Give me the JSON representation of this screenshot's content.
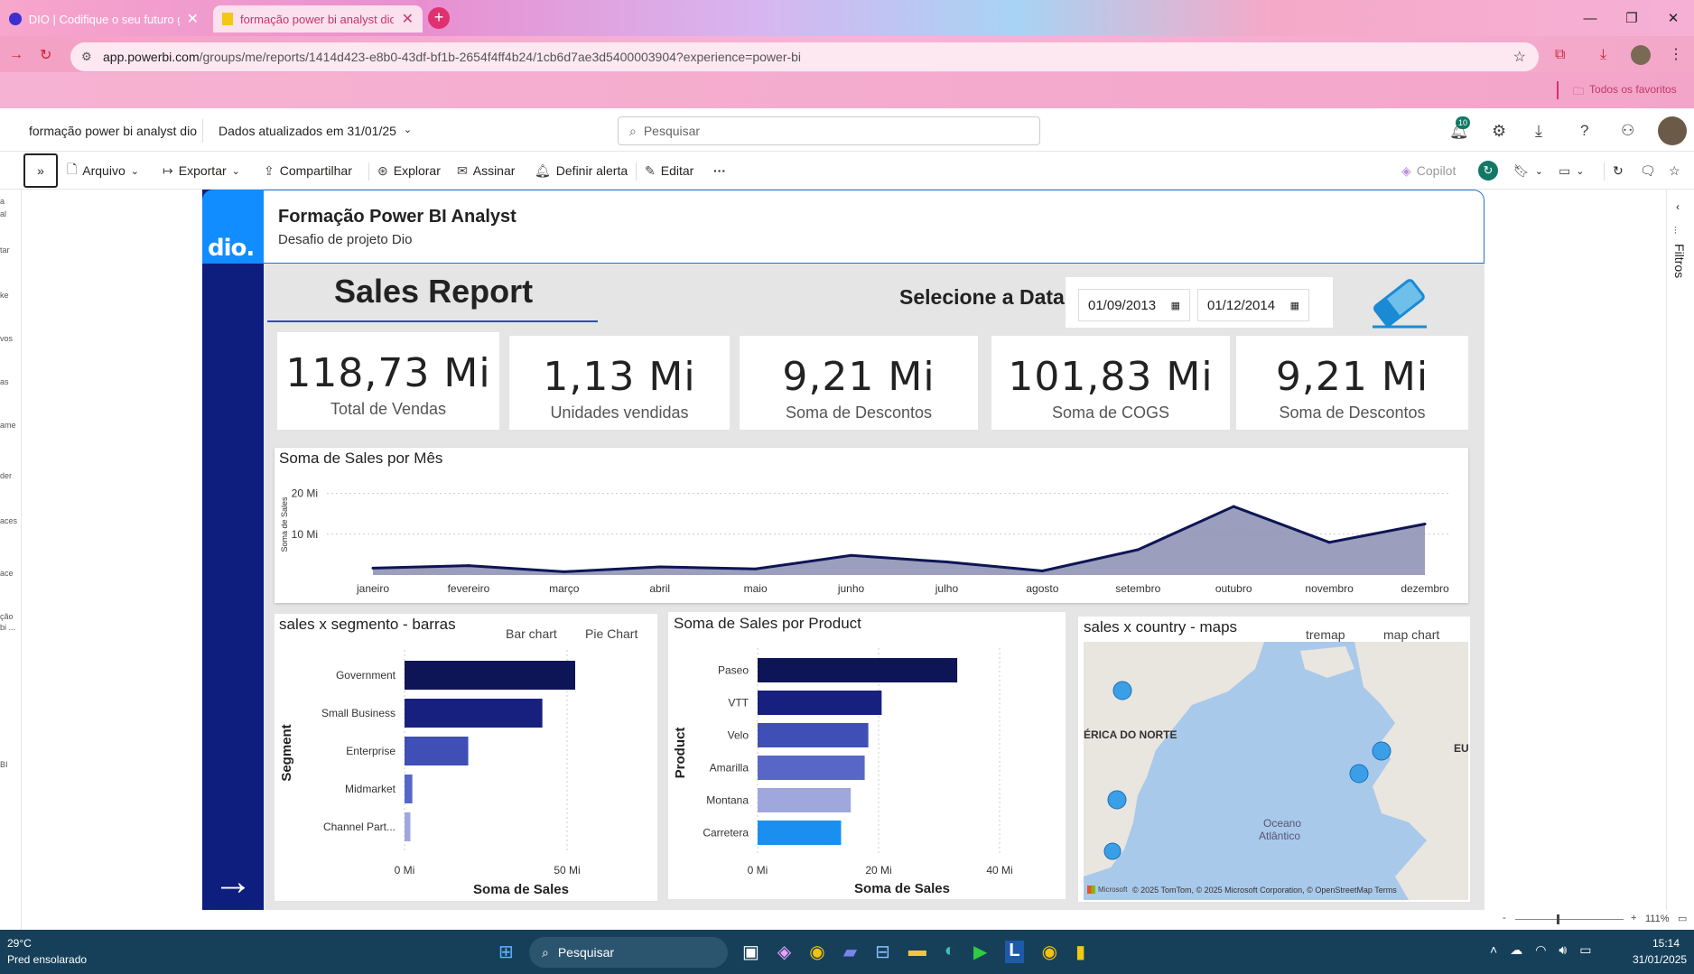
{
  "browser": {
    "tabs": [
      {
        "title": "DIO | Codifique o seu futuro glo",
        "active": false
      },
      {
        "title": "formação power bi analyst dio",
        "active": true
      }
    ],
    "url_host": "app.powerbi.com",
    "url_path": "/groups/me/reports/1414d423-e8b0-43df-bf1b-2654f4ff4b24/1cb6d7ae3d5400003904?experience=power-bi",
    "bookmarks_label": "Todos os favoritos"
  },
  "pbi_header": {
    "workspace": "formação power bi analyst dio",
    "updated": "Dados atualizados em 31/01/25",
    "search_placeholder": "Pesquisar",
    "notif_count": "10"
  },
  "toolbar": {
    "arquivo": "Arquivo",
    "exportar": "Exportar",
    "compartilhar": "Compartilhar",
    "explorar": "Explorar",
    "assinar": "Assinar",
    "definir_alerta": "Definir alerta",
    "editar": "Editar",
    "more": "···",
    "copilot": "Copilot"
  },
  "left_strip": [
    "a",
    "al",
    "tar",
    "ke",
    "vos",
    "as",
    "ame",
    "der",
    "aces",
    "ace",
    "ção",
    "bi ...",
    "BI"
  ],
  "filters_label": "Filtros",
  "report": {
    "logo": "dio.",
    "title": "Formação Power BI Analyst",
    "subtitle": "Desafio de projeto Dio",
    "sales_report": "Sales Report",
    "select_date": "Selecione a Data",
    "date_from": "01/09/2013",
    "date_to": "01/12/2014",
    "kpis": [
      {
        "value": "118,73 Mi",
        "label": "Total de Vendas"
      },
      {
        "value": "1,13 Mi",
        "label": "Unidades vendidas"
      },
      {
        "value": "9,21 Mi",
        "label": "Soma de Descontos"
      },
      {
        "value": "101,83 Mi",
        "label": "Soma de COGS"
      },
      {
        "value": "9,21 Mi",
        "label": "Soma de Descontos"
      }
    ],
    "segment_title": "sales x segmento - barras",
    "segment_tab1": "Bar chart",
    "segment_tab2": "Pie Chart",
    "map_title": "sales x country - maps",
    "map_tab1": "tremap",
    "map_tab2": "map chart",
    "map_labels": {
      "na": "ÉRICA DO NORTE",
      "eu": "EU",
      "ocean1": "Oceano",
      "ocean2": "Atlântico"
    },
    "map_attrib": "© 2025 TomTom, © 2025 Microsoft Corporation, © OpenStreetMap  Terms",
    "map_brand": "Microsoft"
  },
  "chart_data": [
    {
      "type": "area",
      "title": "Soma de Sales por Mês",
      "ylabel": "Soma de Sales",
      "yticks": [
        "10 Mi",
        "20 Mi"
      ],
      "ylim": [
        0,
        25
      ],
      "categories": [
        "janeiro",
        "fevereiro",
        "março",
        "abril",
        "maio",
        "junho",
        "julho",
        "agosto",
        "setembro",
        "outubro",
        "novembro",
        "dezembro"
      ],
      "values": [
        1.7,
        2.3,
        0.8,
        2.0,
        1.5,
        4.8,
        3.2,
        1.0,
        6.2,
        16.8,
        8.0,
        12.5
      ],
      "color": "#0e1556"
    },
    {
      "type": "bar",
      "orientation": "horizontal",
      "xlabel": "Soma de Sales",
      "ylabel": "Segment",
      "xticks": [
        "0 Mi",
        "50 Mi"
      ],
      "xlim": [
        0,
        60
      ],
      "categories": [
        "Government",
        "Small Business",
        "Enterprise",
        "Midmarket",
        "Channel Part..."
      ],
      "values": [
        52.5,
        42.4,
        19.6,
        2.4,
        1.8
      ],
      "colors": [
        "#0e1556",
        "#17207e",
        "#3f4fb5",
        "#5867c7",
        "#9fa7dd"
      ]
    },
    {
      "type": "bar",
      "orientation": "horizontal",
      "title": "Soma de Sales por Product",
      "xlabel": "Soma de Sales",
      "ylabel": "Product",
      "xticks": [
        "0 Mi",
        "20 Mi",
        "40 Mi"
      ],
      "xlim": [
        0,
        40
      ],
      "categories": [
        "Paseo",
        "VTT",
        "Velo",
        "Amarilla",
        "Montana",
        "Carretera"
      ],
      "values": [
        33.0,
        20.5,
        18.3,
        17.7,
        15.4,
        13.8
      ],
      "colors": [
        "#0e1556",
        "#17207e",
        "#3f4fb5",
        "#5867c7",
        "#9fa7dd",
        "#1a8ff0"
      ]
    }
  ],
  "status": {
    "zoom": "111%"
  },
  "taskbar": {
    "temp": "29°C",
    "weather": "Pred ensolarado",
    "search": "Pesquisar",
    "time": "15:14",
    "date": "31/01/2025"
  }
}
